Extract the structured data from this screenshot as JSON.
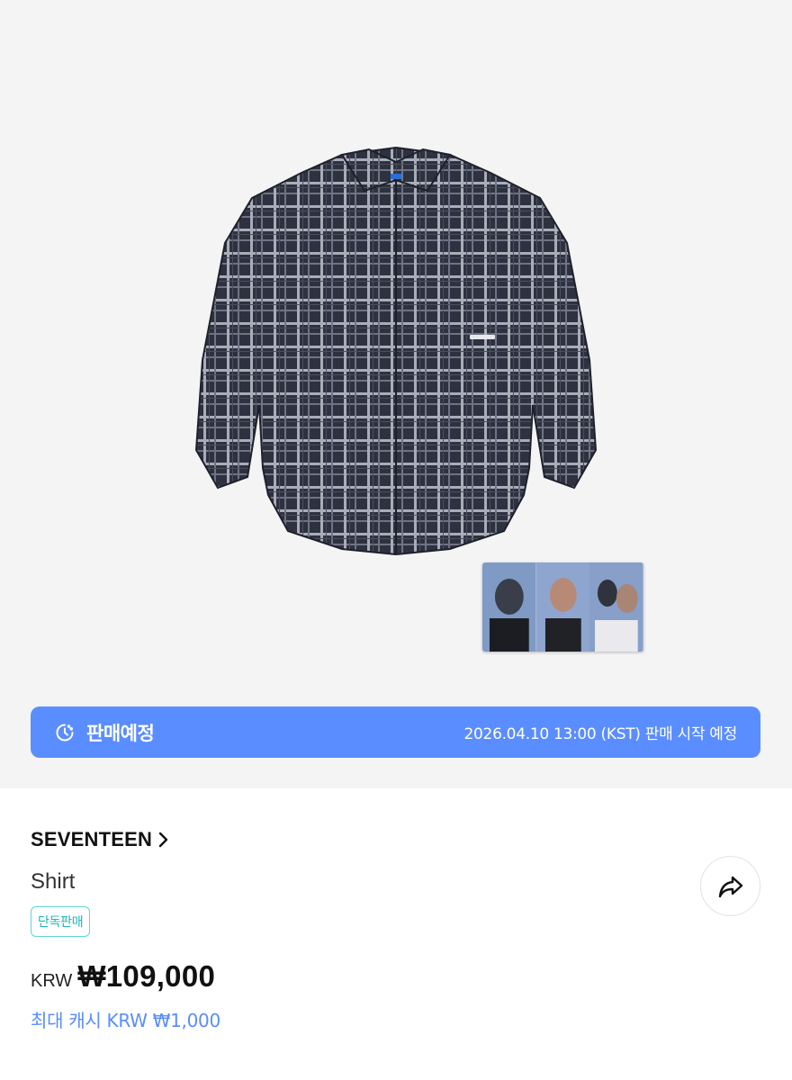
{
  "colors": {
    "accent": "#5a8dff",
    "badge": "#1bb5b5",
    "hero_bg": "#f4f4f4"
  },
  "banner": {
    "status": "판매예정",
    "schedule": "2026.04.10 13:00 (KST) 판매 시작 예정",
    "icon": "clock-icon"
  },
  "product": {
    "artist": "SEVENTEEN",
    "name": "Shirt",
    "badge": "단독판매",
    "currency": "KRW",
    "price": "₩109,000",
    "cash": "최대 캐시 KRW ₩1,000"
  },
  "icons": {
    "share": "share-icon",
    "chevron": "chevron-right-icon"
  }
}
